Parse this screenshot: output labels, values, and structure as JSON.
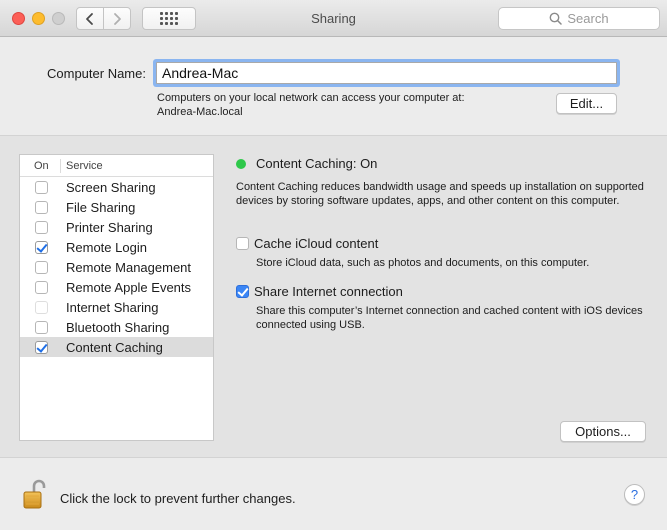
{
  "window": {
    "title": "Sharing"
  },
  "toolbar": {
    "search_placeholder": "Search"
  },
  "computer_name": {
    "label": "Computer Name:",
    "value": "Andrea-Mac",
    "help_line1": "Computers on your local network can access your computer at:",
    "help_line2": "Andrea-Mac.local",
    "edit_label": "Edit..."
  },
  "services": {
    "col_on": "On",
    "col_service": "Service",
    "items": [
      {
        "label": "Screen Sharing",
        "checked": false
      },
      {
        "label": "File Sharing",
        "checked": false
      },
      {
        "label": "Printer Sharing",
        "checked": false
      },
      {
        "label": "Remote Login",
        "checked": true
      },
      {
        "label": "Remote Management",
        "checked": false
      },
      {
        "label": "Remote Apple Events",
        "checked": false
      },
      {
        "label": "Internet Sharing",
        "checked": false
      },
      {
        "label": "Bluetooth Sharing",
        "checked": false
      },
      {
        "label": "Content Caching",
        "checked": true,
        "selected": true
      }
    ]
  },
  "detail": {
    "status": "Content Caching: On",
    "status_color": "#2ec84a",
    "description": "Content Caching reduces bandwidth usage and speeds up installation on supported devices by storing software updates, apps, and other content on this computer.",
    "option1_label": "Cache iCloud content",
    "option1_checked": false,
    "option1_sub": "Store iCloud data, such as photos and documents, on this computer.",
    "option2_label": "Share Internet connection",
    "option2_checked": true,
    "option2_sub": "Share this computer’s Internet connection and cached content with iOS devices connected using USB.",
    "options_label": "Options..."
  },
  "footer": {
    "lock_text": "Click the lock to prevent further changes.",
    "help_label": "?"
  }
}
